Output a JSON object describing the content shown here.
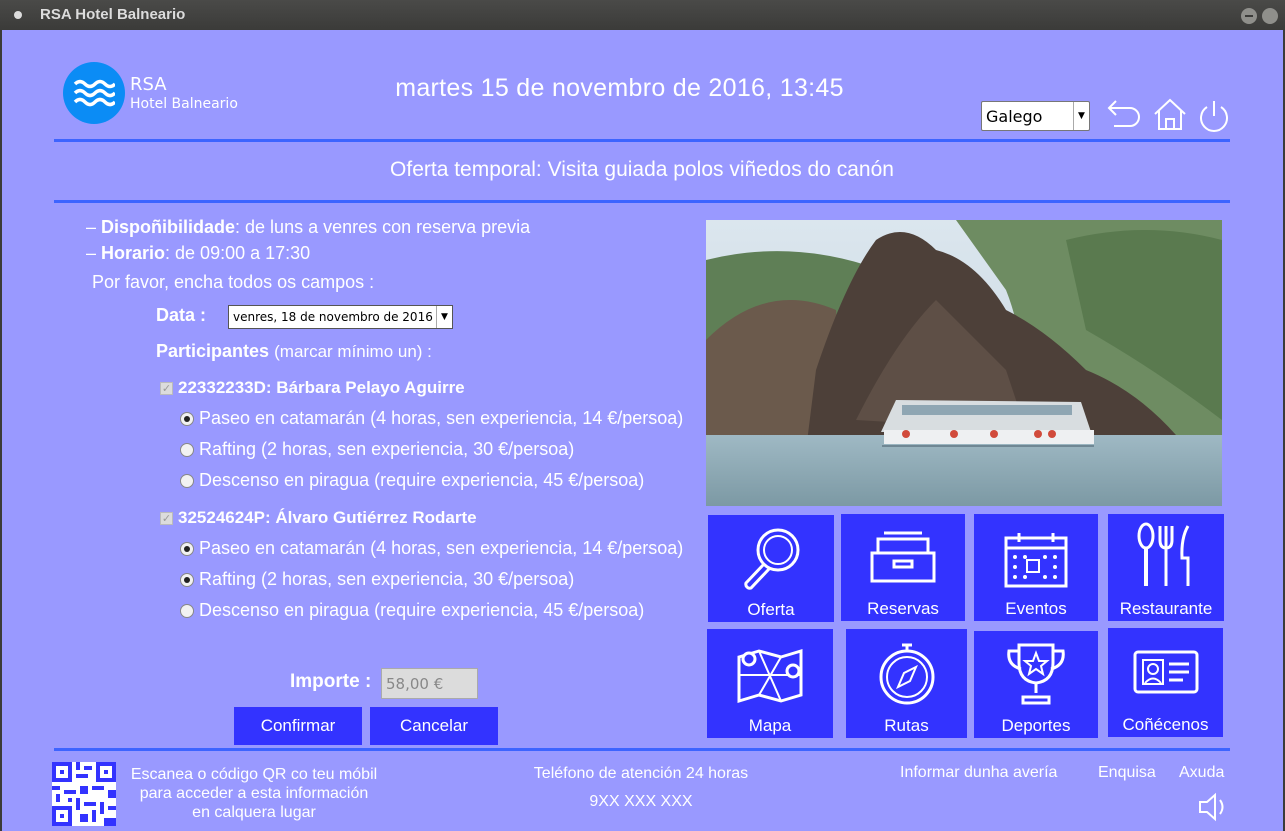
{
  "window": {
    "title": "RSA Hotel Balneario"
  },
  "brand": {
    "name": "RSA",
    "subtitle": "Hotel Balneario"
  },
  "header": {
    "datetime": "martes 15 de novembro de 2016, 13:45",
    "language": "Galego"
  },
  "offer": {
    "heading": "Oferta temporal: Visita guiada polos viñedos do canón",
    "availability_label": "Dispoñibilidade",
    "availability_text": ": de luns a venres con reserva previa",
    "schedule_label": "Horario",
    "schedule_text": ": de 09:00 a 17:30",
    "instruction": "Por favor, encha todos os campos :"
  },
  "form": {
    "date_label": "Data :",
    "date_value": "venres, 18 de novembro de 2016",
    "participants_label": "Participantes",
    "participants_hint": "(marcar mínimo un) :",
    "participants": [
      {
        "name": "22332233D: Bárbara Pelayo Aguirre",
        "checked": true,
        "options": [
          {
            "label": "Paseo en catamarán (4 horas, sen experiencia, 14 €/persoa)",
            "selected": true
          },
          {
            "label": "Rafting (2 horas, sen experiencia, 30 €/persoa)",
            "selected": false
          },
          {
            "label": "Descenso en piragua (require experiencia, 45 €/persoa)",
            "selected": false
          }
        ]
      },
      {
        "name": "32524624P: Álvaro Gutiérrez Rodarte",
        "checked": true,
        "options": [
          {
            "label": "Paseo en catamarán (4 horas, sen experiencia, 14 €/persoa)",
            "selected": true
          },
          {
            "label": "Rafting (2 horas, sen experiencia, 30 €/persoa)",
            "selected": true
          },
          {
            "label": "Descenso en piragua (require experiencia, 45 €/persoa)",
            "selected": false
          }
        ]
      }
    ],
    "amount_label": "Importe :",
    "amount_value": "58,00 €",
    "confirm_label": "Confirmar",
    "cancel_label": "Cancelar"
  },
  "tiles": [
    "Oferta",
    "Reservas",
    "Eventos",
    "Restaurante",
    "Mapa",
    "Rutas",
    "Deportes",
    "Coñécenos"
  ],
  "footer": {
    "qr_text_1": "Escanea o código QR co teu móbil",
    "qr_text_2": "para acceder a esta información",
    "qr_text_3": "en calquera lugar",
    "phone_label": "Teléfono de atención 24 horas",
    "phone_number": "9XX XXX XXX",
    "links": [
      "Informar dunha avería",
      "Enquisa",
      "Axuda"
    ]
  },
  "colors": {
    "background": "#9999ff",
    "tile": "#3333ff",
    "rule": "#3d64ff",
    "logo": "#0b8cf5"
  }
}
